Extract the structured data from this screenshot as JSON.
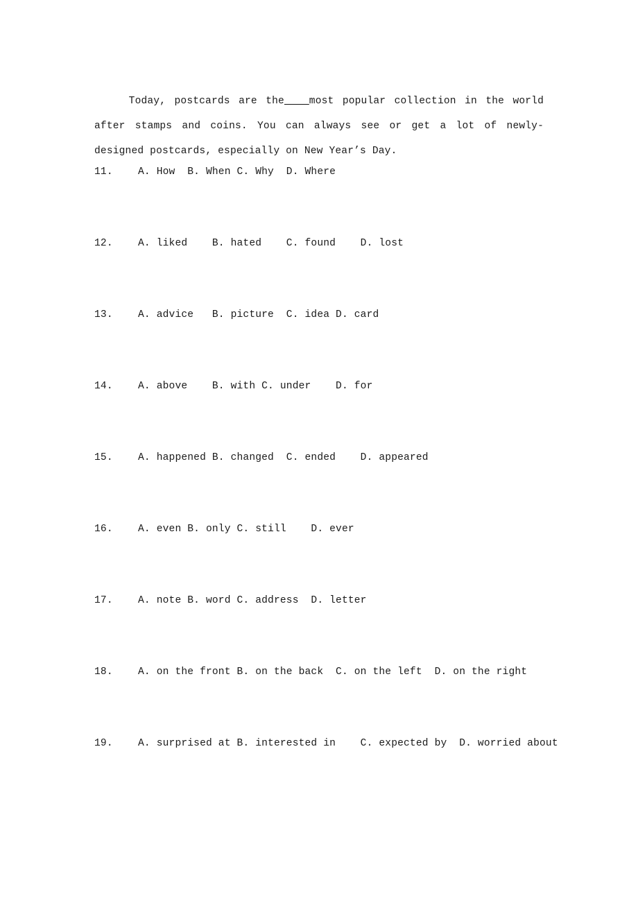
{
  "document": {
    "type": "english-cloze-test-worksheet",
    "background_color": "#ffffff",
    "text_color": "#1a1a1a"
  },
  "passage": {
    "before_blank": "    Today, postcards are the",
    "blank": "____",
    "after_blank": "most popular collection in the world after stamps and coins. You can always see or get a lot of newly-designed postcards, especially on New Year’s Day.",
    "full_text": "    Today, postcards are the____most popular collection in the world after stamps and coins. You can always see or get a lot of newly-designed postcards, especially on New Year’s Day."
  },
  "questions": [
    {
      "number": "11.",
      "options_text": "A. How  B. When C. Why  D. Where",
      "options": [
        {
          "letter": "A.",
          "text": "How"
        },
        {
          "letter": "B.",
          "text": "When"
        },
        {
          "letter": "C.",
          "text": "Why"
        },
        {
          "letter": "D.",
          "text": "Where"
        }
      ]
    },
    {
      "number": "12.",
      "options_text": "A. liked    B. hated    C. found    D. lost",
      "options": [
        {
          "letter": "A.",
          "text": "liked"
        },
        {
          "letter": "B.",
          "text": "hated"
        },
        {
          "letter": "C.",
          "text": "found"
        },
        {
          "letter": "D.",
          "text": "lost"
        }
      ]
    },
    {
      "number": "13.",
      "options_text": "A. advice   B. picture  C. idea D. card",
      "options": [
        {
          "letter": "A.",
          "text": "advice"
        },
        {
          "letter": "B.",
          "text": "picture"
        },
        {
          "letter": "C.",
          "text": "idea"
        },
        {
          "letter": "D.",
          "text": "card"
        }
      ]
    },
    {
      "number": "14.",
      "options_text": "A. above    B. with C. under    D. for",
      "options": [
        {
          "letter": "A.",
          "text": "above"
        },
        {
          "letter": "B.",
          "text": "with"
        },
        {
          "letter": "C.",
          "text": "under"
        },
        {
          "letter": "D.",
          "text": "for"
        }
      ]
    },
    {
      "number": "15.",
      "options_text": "A. happened B. changed  C. ended    D. appeared",
      "options": [
        {
          "letter": "A.",
          "text": "happened"
        },
        {
          "letter": "B.",
          "text": "changed"
        },
        {
          "letter": "C.",
          "text": "ended"
        },
        {
          "letter": "D.",
          "text": "appeared"
        }
      ]
    },
    {
      "number": "16.",
      "options_text": "A. even B. only C. still    D. ever",
      "options": [
        {
          "letter": "A.",
          "text": "even"
        },
        {
          "letter": "B.",
          "text": "only"
        },
        {
          "letter": "C.",
          "text": "still"
        },
        {
          "letter": "D.",
          "text": "ever"
        }
      ]
    },
    {
      "number": "17.",
      "options_text": "A. note B. word C. address  D. letter",
      "options": [
        {
          "letter": "A.",
          "text": "note"
        },
        {
          "letter": "B.",
          "text": "word"
        },
        {
          "letter": "C.",
          "text": "address"
        },
        {
          "letter": "D.",
          "text": "letter"
        }
      ]
    },
    {
      "number": "18.",
      "options_text": "A. on the front B. on the back  C. on the left  D. on the right",
      "options": [
        {
          "letter": "A.",
          "text": "on the front"
        },
        {
          "letter": "B.",
          "text": "on the back"
        },
        {
          "letter": "C.",
          "text": "on the left"
        },
        {
          "letter": "D.",
          "text": "on the right"
        }
      ]
    },
    {
      "number": "19.",
      "options_text": "A. surprised at B. interested in    C. expected by  D. worried about",
      "options": [
        {
          "letter": "A.",
          "text": "surprised at"
        },
        {
          "letter": "B.",
          "text": "interested in"
        },
        {
          "letter": "C.",
          "text": "expected by"
        },
        {
          "letter": "D.",
          "text": "worried about"
        }
      ]
    }
  ]
}
